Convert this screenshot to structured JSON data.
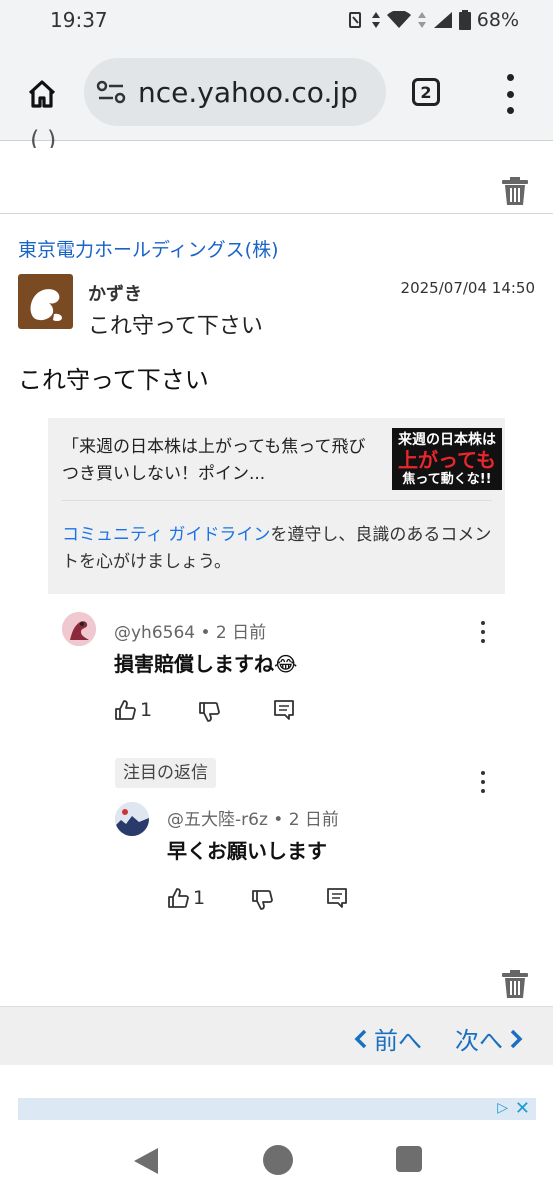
{
  "status_bar": {
    "time": "19:37",
    "battery": "68%"
  },
  "browser": {
    "url": "nce.yahoo.co.jp",
    "tab_count": "2"
  },
  "previous_post": {
    "cut_text": "(     )"
  },
  "post": {
    "stock_link": "東京電力ホールディングス(株)",
    "username": "かずき",
    "date": "2025/07/04 14:50",
    "title": "これ守って下さい",
    "body": "これ守って下さい"
  },
  "embed": {
    "article_text": "「来週の日本株は上がっても焦って飛びつき買いしない！ポイン...",
    "thumbnail": {
      "line1": "来週の日本株は",
      "line2": "上がっても",
      "line3": "焦って動くな!!"
    },
    "guide_link": "コミュニティ ガイドライン",
    "guide_text": "を遵守し、良識のあるコメントを心がけましょう。"
  },
  "comments": [
    {
      "handle": "@yh6564 • 2 日前",
      "text": "損害賠償しますね😂",
      "likes": "1"
    }
  ],
  "featured_reply_label": "注目の返信",
  "replies": [
    {
      "handle": "@五大陸-r6z • 2 日前",
      "text": "早くお願いします",
      "likes": "1"
    }
  ],
  "pager": {
    "prev": "前へ",
    "next": "次へ"
  },
  "icons": [
    "home-icon",
    "site-settings-icon",
    "tabs-icon",
    "menu-icon",
    "trash-icon",
    "thumbs-up-icon",
    "thumbs-down-icon",
    "reply-icon",
    "more-icon",
    "chevron-left-icon",
    "chevron-right-icon",
    "adchoices-icon",
    "close-icon",
    "back-icon",
    "home-circle-icon",
    "recents-icon"
  ],
  "colors": {
    "link": "#1a64c8",
    "chrome": "#f1f3f4",
    "avatar": "#7a4b22"
  }
}
